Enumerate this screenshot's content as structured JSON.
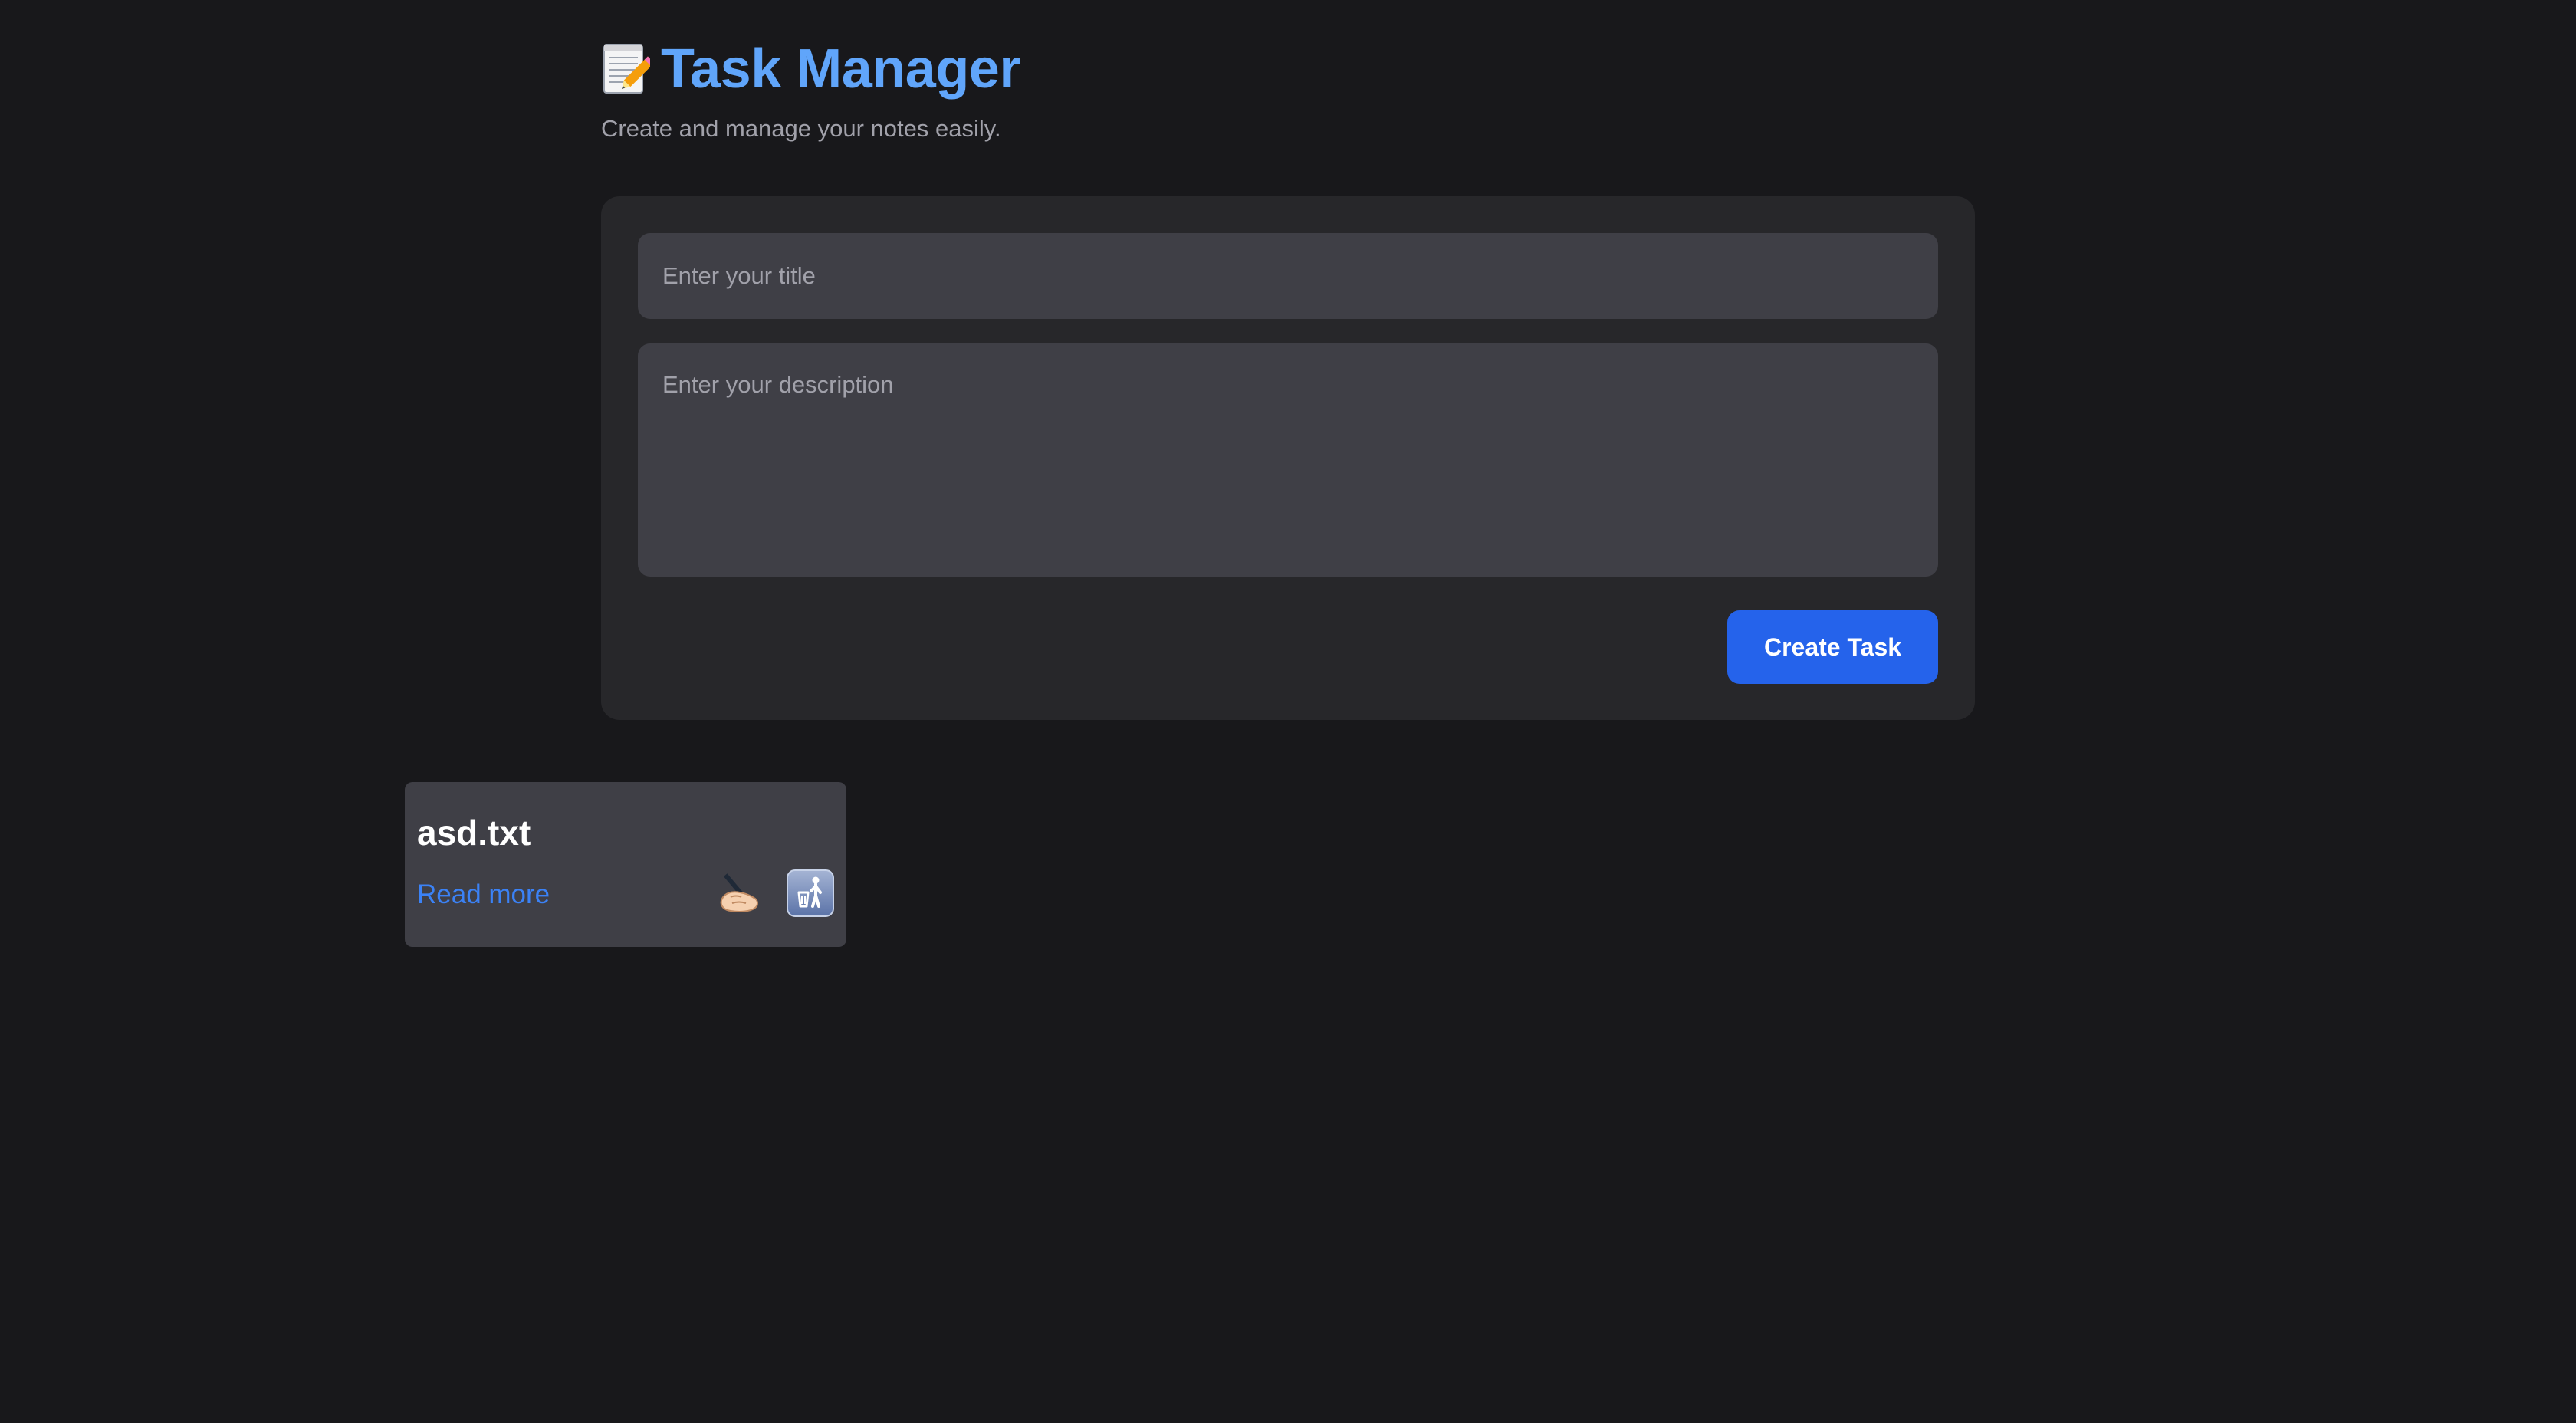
{
  "header": {
    "icon": "memo-icon",
    "title": "Task Manager",
    "subtitle": "Create and manage your notes easily."
  },
  "form": {
    "title_placeholder": "Enter your title",
    "title_value": "",
    "description_placeholder": "Enter your description",
    "description_value": "",
    "submit_label": "Create Task"
  },
  "tasks": [
    {
      "title": "asd.txt",
      "read_more_label": "Read more",
      "edit_icon": "writing-hand-icon",
      "delete_icon": "trash-icon"
    }
  ],
  "colors": {
    "background": "#18181b",
    "card": "#27272a",
    "input": "#3f3f46",
    "accent_title": "#60a5fa",
    "button": "#2563eb",
    "link": "#3b82f6"
  }
}
